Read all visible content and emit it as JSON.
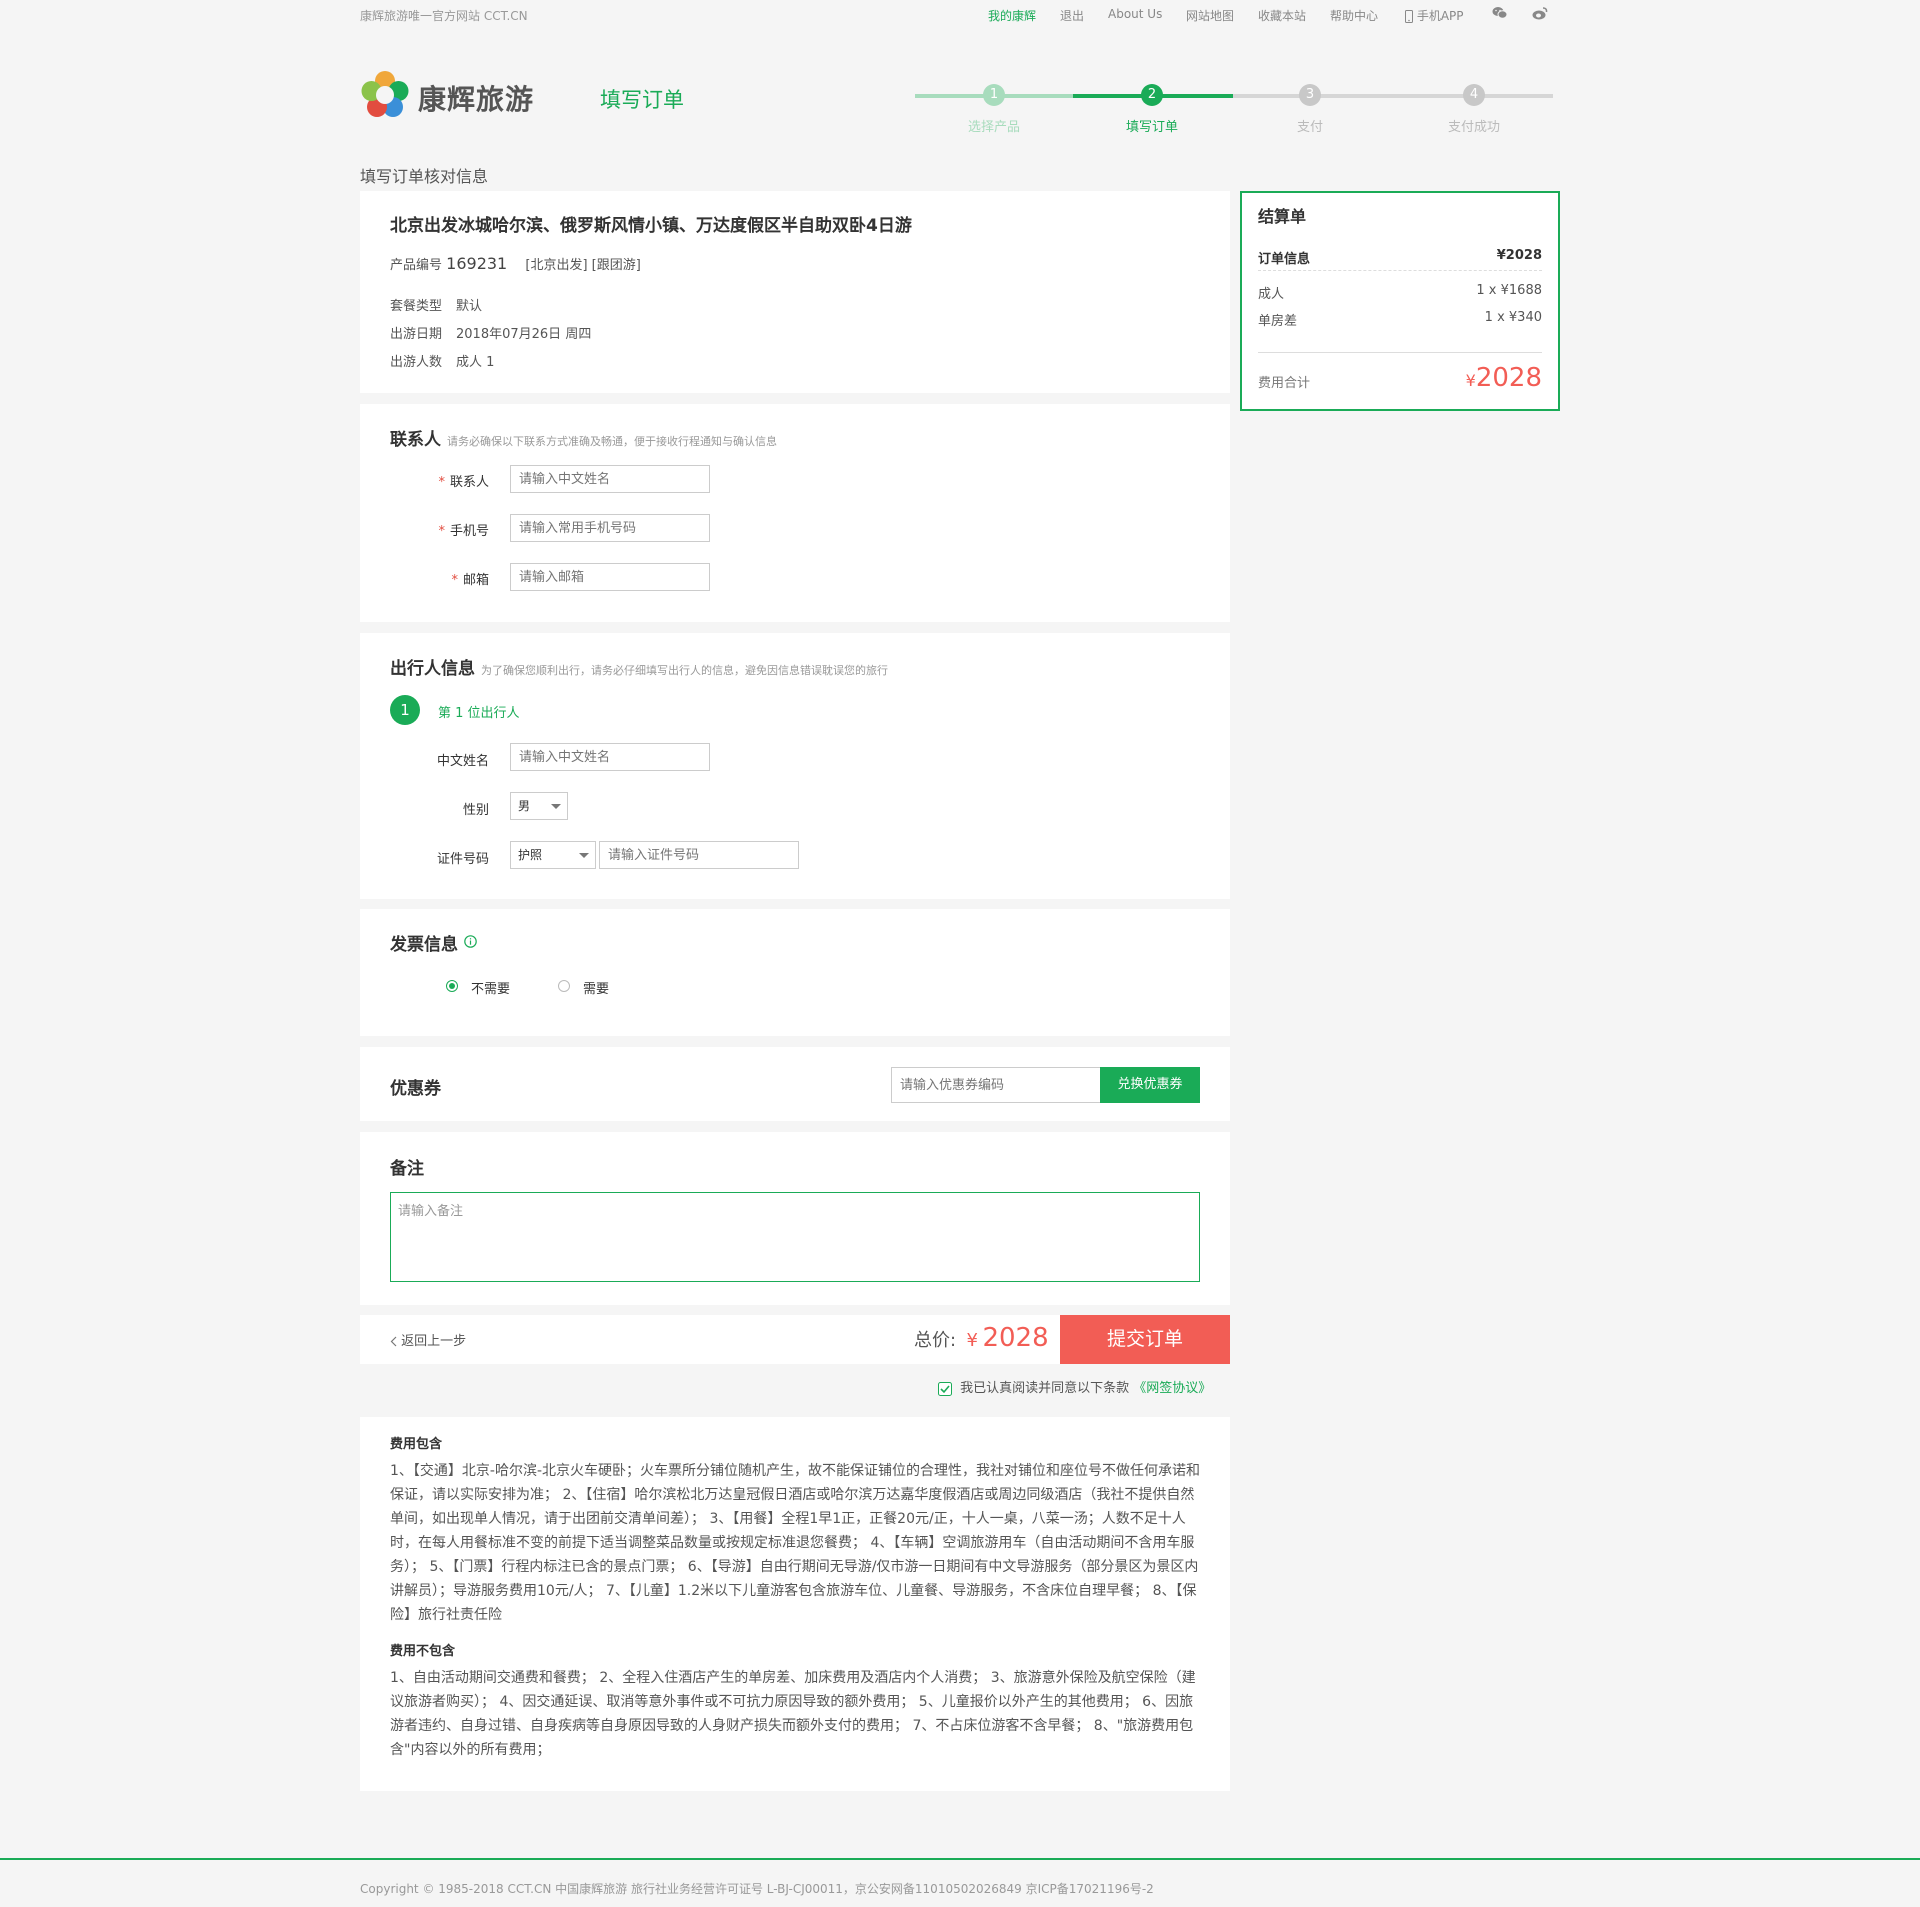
{
  "topbar": {
    "site_name": "康辉旅游唯一官方网站 CCT.CN",
    "nav": [
      "我的康辉",
      "退出",
      "About Us",
      "网站地图",
      "收藏本站",
      "帮助中心",
      "手机APP"
    ],
    "wechat_icon": "wechat-icon",
    "weibo_icon": "weibo-icon",
    "accent": "#1aab57"
  },
  "header": {
    "brand": "康辉旅游",
    "page_title": "填写订单"
  },
  "steps": [
    {
      "num": "1",
      "label": "选择产品",
      "state": "done"
    },
    {
      "num": "2",
      "label": "填写订单",
      "state": "active"
    },
    {
      "num": "3",
      "label": "支付",
      "state": "todo"
    },
    {
      "num": "4",
      "label": "支付成功",
      "state": "todo"
    }
  ],
  "section_title": "填写订单核对信息",
  "product": {
    "name": "北京出发冰城哈尔滨、俄罗斯风情小镇、万达度假区半自助双卧4日游",
    "code_label": "产品编号",
    "code": "169231",
    "tags": "[北京出发] [跟团游]",
    "package_label": "套餐类型",
    "package_value": "默认",
    "date_label": "出游日期",
    "date_value": "2018年07月26日 周四",
    "people_label": "出游人数",
    "people_value": "成人 1"
  },
  "contact": {
    "title": "联系人",
    "hint": "请务必确保以下联系方式准确及畅通，便于接收行程通知与确认信息",
    "fields": [
      {
        "label": "联系人",
        "placeholder": "请输入中文姓名"
      },
      {
        "label": "手机号",
        "placeholder": "请输入常用手机号码"
      },
      {
        "label": "邮箱",
        "placeholder": "请输入邮箱"
      }
    ]
  },
  "traveler": {
    "title": "出行人信息",
    "hint": "为了确保您顺利出行，请务必仔细填写出行人的信息，避免因信息错误耽误您的旅行",
    "index": "1",
    "index_label": "第 1 位出行人",
    "name_label": "中文姓名",
    "name_placeholder": "请输入中文姓名",
    "gender_label": "性别",
    "gender_value": "男",
    "id_label": "证件号码",
    "id_type": "护照",
    "id_placeholder": "请输入证件号码"
  },
  "invoice": {
    "title": "发票信息",
    "info_icon": "info-icon",
    "options": [
      {
        "label": "不需要",
        "selected": true
      },
      {
        "label": "需要",
        "selected": false
      }
    ]
  },
  "coupon": {
    "title": "优惠券",
    "placeholder": "请输入优惠券编码",
    "button": "兑换优惠券"
  },
  "remark": {
    "title": "备注",
    "placeholder": "请输入备注"
  },
  "bottom": {
    "back": "返回上一步",
    "total_label": "总价:",
    "currency": "¥",
    "total": "2028",
    "submit": "提交订单",
    "agree_text": "我已认真阅读并同意以下条款",
    "agree_link": "《网签协议》",
    "price_color": "#f25d55"
  },
  "summary": {
    "title": "结算单",
    "order_label": "订单信息",
    "order_value": "¥2028",
    "items": [
      {
        "name": "成人",
        "value": "1 x ¥1688"
      },
      {
        "name": "单房差",
        "value": "1 x ¥340"
      }
    ],
    "total_label": "费用合计",
    "currency": "¥",
    "total": "2028"
  },
  "fees": {
    "include_title": "费用包含",
    "include_text": "1、【交通】北京-哈尔滨-北京火车硬卧；火车票所分铺位随机产生，故不能保证铺位的合理性，我社对铺位和座位号不做任何承诺和保证，请以实际安排为准； 2、【住宿】哈尔滨松北万达皇冠假日酒店或哈尔滨万达嘉华度假酒店或周边同级酒店（我社不提供自然单间，如出现单人情况，请于出团前交清单间差）； 3、【用餐】全程1早1正，正餐20元/正，十人一桌，八菜一汤；人数不足十人时，在每人用餐标准不变的前提下适当调整菜品数量或按规定标准退您餐费； 4、【车辆】空调旅游用车（自由活动期间不含用车服务）； 5、【门票】行程内标注已含的景点门票； 6、【导游】自由行期间无导游/仅市游一日期间有中文导游服务（部分景区为景区内讲解员）；导游服务费用10元/人； 7、【儿童】1.2米以下儿童游客包含旅游车位、儿童餐、导游服务，不含床位自理早餐； 8、【保险】旅行社责任险",
    "exclude_title": "费用不包含",
    "exclude_text": "1、自由活动期间交通费和餐费； 2、全程入住酒店产生的单房差、加床费用及酒店内个人消费； 3、旅游意外保险及航空保险（建议旅游者购买）； 4、因交通延误、取消等意外事件或不可抗力原因导致的额外费用； 5、儿童报价以外产生的其他费用； 6、因旅游者违约、自身过错、自身疾病等自身原因导致的人身财产损失而额外支付的费用； 7、不占床位游客不含早餐； 8、\"旅游费用包含\"内容以外的所有费用；"
  },
  "footer": "Copyright © 1985-2018 CCT.CN 中国康辉旅游 旅行社业务经营许可证号 L-BJ-CJ00011，京公安网备11010502026849 京ICP备17021196号-2"
}
